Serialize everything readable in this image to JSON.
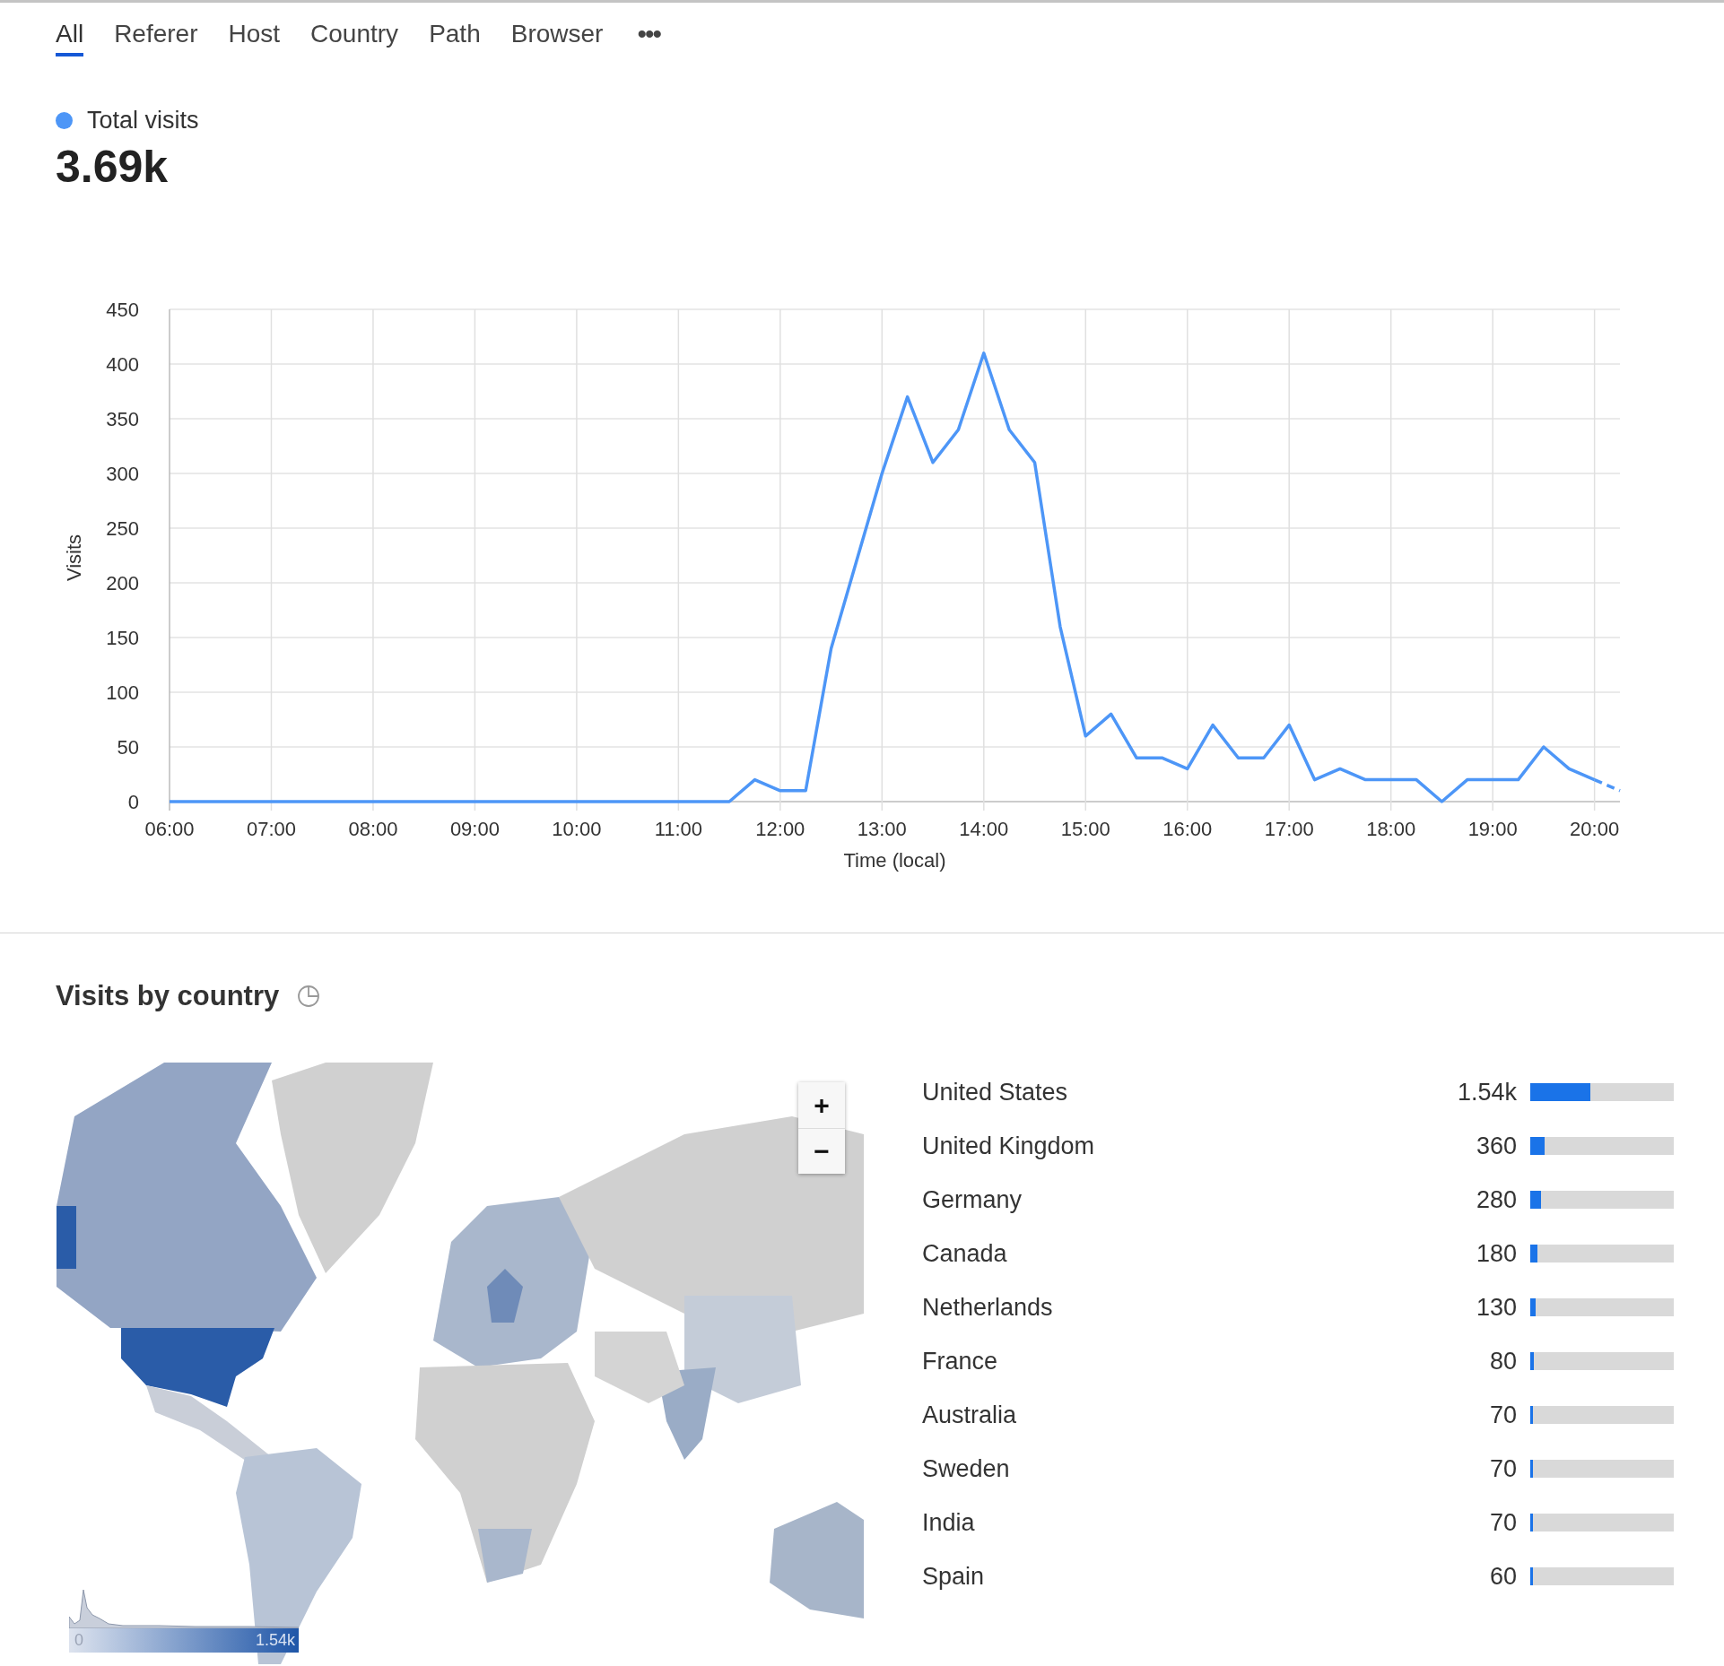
{
  "tabs": [
    {
      "label": "All",
      "selected": true
    },
    {
      "label": "Referer",
      "selected": false
    },
    {
      "label": "Host",
      "selected": false
    },
    {
      "label": "Country",
      "selected": false
    },
    {
      "label": "Path",
      "selected": false
    },
    {
      "label": "Browser",
      "selected": false
    }
  ],
  "more_button": "•••",
  "summary": {
    "value": "3.69k"
  },
  "chart_data": {
    "type": "line",
    "xlabel": "Time (local)",
    "ylabel": "Visits",
    "x": [
      6,
      6.25,
      6.5,
      6.75,
      7,
      7.25,
      7.5,
      7.75,
      8,
      8.25,
      8.5,
      8.75,
      9,
      9.25,
      9.5,
      9.75,
      10,
      10.25,
      10.5,
      10.75,
      11,
      11.25,
      11.5,
      11.75,
      12,
      12.25,
      12.5,
      12.75,
      13,
      13.25,
      13.5,
      13.75,
      14,
      14.25,
      14.5,
      14.75,
      15,
      15.25,
      15.5,
      15.75,
      16,
      16.25,
      16.5,
      16.75,
      17,
      17.25,
      17.5,
      17.75,
      18,
      18.25,
      18.5,
      18.75,
      19,
      19.25,
      19.5,
      19.75,
      20,
      20.25
    ],
    "series": [
      {
        "name": "Total visits",
        "color": "#4d96f7",
        "values": [
          0,
          0,
          0,
          0,
          0,
          0,
          0,
          0,
          0,
          0,
          0,
          0,
          0,
          0,
          0,
          0,
          0,
          0,
          0,
          0,
          0,
          0,
          0,
          20,
          10,
          10,
          140,
          220,
          300,
          370,
          310,
          340,
          410,
          340,
          310,
          160,
          60,
          80,
          40,
          40,
          30,
          70,
          40,
          40,
          70,
          20,
          30,
          20,
          20,
          20,
          0,
          20,
          20,
          20,
          50,
          30,
          20,
          10
        ]
      }
    ],
    "grid": true,
    "xlim": [
      6,
      20.25
    ],
    "ylim": [
      0,
      450
    ],
    "xticks": [
      {
        "value": 6,
        "label": "06:00"
      },
      {
        "value": 7,
        "label": "07:00"
      },
      {
        "value": 8,
        "label": "08:00"
      },
      {
        "value": 9,
        "label": "09:00"
      },
      {
        "value": 10,
        "label": "10:00"
      },
      {
        "value": 11,
        "label": "11:00"
      },
      {
        "value": 12,
        "label": "12:00"
      },
      {
        "value": 13,
        "label": "13:00"
      },
      {
        "value": 14,
        "label": "14:00"
      },
      {
        "value": 15,
        "label": "15:00"
      },
      {
        "value": 16,
        "label": "16:00"
      },
      {
        "value": 17,
        "label": "17:00"
      },
      {
        "value": 18,
        "label": "18:00"
      },
      {
        "value": 19,
        "label": "19:00"
      },
      {
        "value": 20,
        "label": "20:00"
      }
    ],
    "yticks": [
      0,
      50,
      100,
      150,
      200,
      250,
      300,
      350,
      400,
      450
    ]
  },
  "countries": {
    "title": "Visits by country",
    "map": {
      "kind": "picture",
      "zoom_in": "+",
      "zoom_out": "−",
      "legend": {
        "min": "0",
        "max": "1.54k"
      }
    },
    "rows": [
      {
        "name": "United States",
        "value": "1.54k",
        "level": 0.417
      },
      {
        "name": "United Kingdom",
        "value": "360",
        "level": 0.098
      },
      {
        "name": "Germany",
        "value": "280",
        "level": 0.076
      },
      {
        "name": "Canada",
        "value": "180",
        "level": 0.049
      },
      {
        "name": "Netherlands",
        "value": "130",
        "level": 0.035
      },
      {
        "name": "France",
        "value": "80",
        "level": 0.022
      },
      {
        "name": "Australia",
        "value": "70",
        "level": 0.019
      },
      {
        "name": "Sweden",
        "value": "70",
        "level": 0.019
      },
      {
        "name": "India",
        "value": "70",
        "level": 0.019
      },
      {
        "name": "Spain",
        "value": "60",
        "level": 0.016
      }
    ]
  }
}
